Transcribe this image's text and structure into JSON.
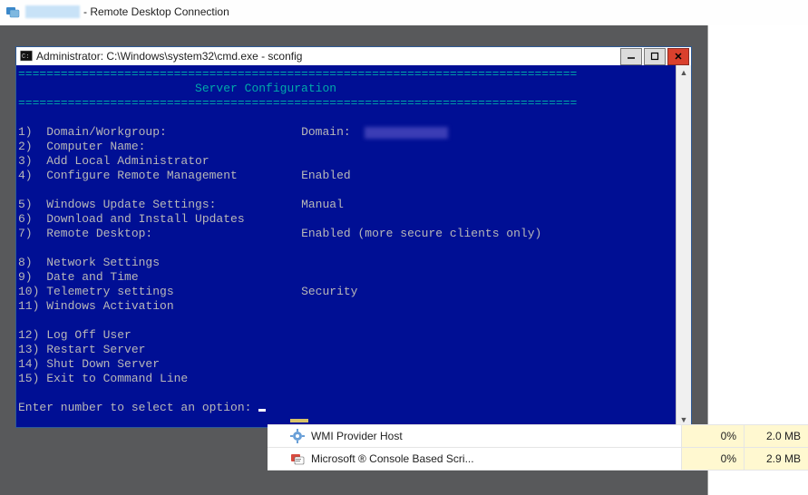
{
  "rdc": {
    "title_suffix": "- Remote Desktop Connection"
  },
  "cmd": {
    "title": "Administrator: C:\\Windows\\system32\\cmd.exe - sconfig",
    "divider": "===============================================================================",
    "header": "                         Server Configuration",
    "options": [
      {
        "num": "1)",
        "label": "Domain/Workgroup:",
        "value_label": "Domain:",
        "value_blurred": true
      },
      {
        "num": "2)",
        "label": "Computer Name:",
        "value_label": "",
        "value": ""
      },
      {
        "num": "3)",
        "label": "Add Local Administrator",
        "value_label": "",
        "value": ""
      },
      {
        "num": "4)",
        "label": "Configure Remote Management",
        "value_label": "",
        "value": "Enabled"
      },
      {
        "spacer": true
      },
      {
        "num": "5)",
        "label": "Windows Update Settings:",
        "value_label": "",
        "value": "Manual"
      },
      {
        "num": "6)",
        "label": "Download and Install Updates",
        "value_label": "",
        "value": ""
      },
      {
        "num": "7)",
        "label": "Remote Desktop:",
        "value_label": "",
        "value": "Enabled (more secure clients only)"
      },
      {
        "spacer": true
      },
      {
        "num": "8)",
        "label": "Network Settings",
        "value_label": "",
        "value": ""
      },
      {
        "num": "9)",
        "label": "Date and Time",
        "value_label": "",
        "value": ""
      },
      {
        "num": "10)",
        "label": "Telemetry settings",
        "value_label": "",
        "value": "Security"
      },
      {
        "num": "11)",
        "label": "Windows Activation",
        "value_label": "",
        "value": ""
      },
      {
        "spacer": true
      },
      {
        "num": "12)",
        "label": "Log Off User",
        "value_label": "",
        "value": ""
      },
      {
        "num": "13)",
        "label": "Restart Server",
        "value_label": "",
        "value": ""
      },
      {
        "num": "14)",
        "label": "Shut Down Server",
        "value_label": "",
        "value": ""
      },
      {
        "num": "15)",
        "label": "Exit to Command Line",
        "value_label": "",
        "value": ""
      }
    ],
    "prompt": "Enter number to select an option: "
  },
  "processes": [
    {
      "icon": "gear",
      "name": "WMI Provider Host",
      "cpu": "0%",
      "mem": "2.0 MB"
    },
    {
      "icon": "mmc",
      "name": "Microsoft ® Console Based Scri...",
      "cpu": "0%",
      "mem": "2.9 MB"
    }
  ]
}
